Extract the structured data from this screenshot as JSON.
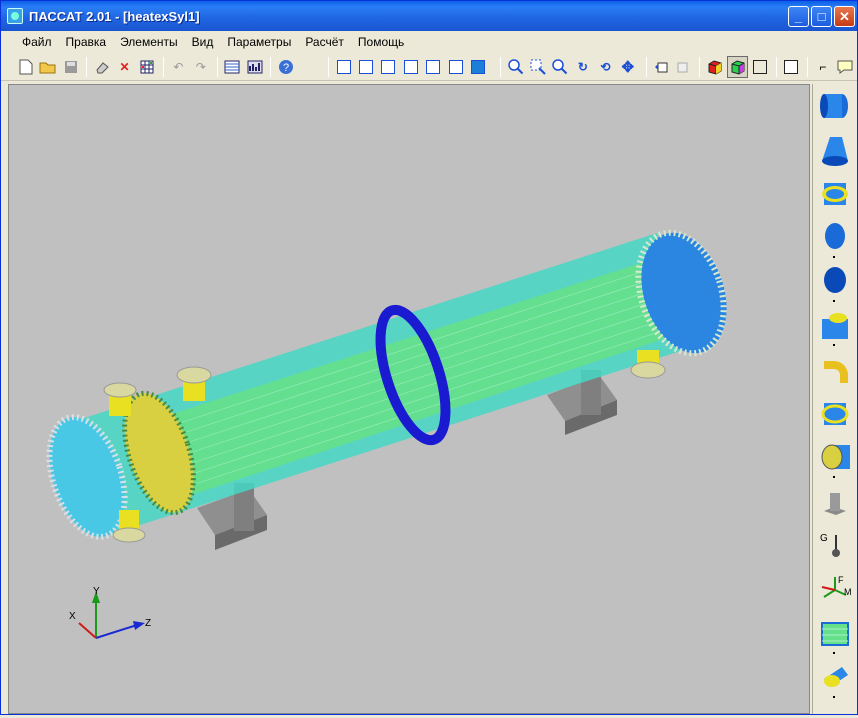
{
  "window": {
    "title": "ПАССАТ 2.01 - [heatexSyl1]"
  },
  "menu": [
    "Файл",
    "Правка",
    "Элементы",
    "Вид",
    "Параметры",
    "Расчёт",
    "Помощь"
  ],
  "toolbar": {
    "file": [
      "new-icon",
      "open-icon",
      "save-icon"
    ],
    "edit": [
      "eraser-icon",
      "delete-icon",
      "grid-icon",
      "undo-icon",
      "redo-icon",
      "table-icon",
      "report-icon",
      "help-icon"
    ],
    "views": [
      "view-front-icon",
      "view-back-icon",
      "view-left-icon",
      "view-right-icon",
      "view-top-icon",
      "view-bottom-icon",
      "view-iso-icon"
    ],
    "zoom": [
      "zoom-in-icon",
      "zoom-window-icon",
      "zoom-icon",
      "rotate-icon",
      "rotate-free-icon",
      "pan-icon"
    ],
    "misc": [
      "undo-view-icon",
      "redo-view-icon",
      "shaded-icon",
      "shaded-edges-icon",
      "wireframe-icon",
      "hidden-lines-icon",
      "measure-icon",
      "annotation-icon"
    ]
  },
  "axes": {
    "x": "X",
    "y": "Y",
    "z": "Z"
  },
  "palette": [
    "shell-cylinder-icon",
    "cone-icon",
    "flange-ring-icon",
    "head-ellipse-icon",
    "head-flat-icon",
    "nozzle-icon",
    "elbow-icon",
    "expansion-joint-icon",
    "tubesheet-icon",
    "saddle-support-icon",
    "gravity-load-icon",
    "force-moment-icon",
    "tube-bundle-icon",
    "nozzle-shell-icon"
  ],
  "colors": {
    "accent": "#0a5fe8",
    "shell": "#3fd3c8",
    "tubes": "#6fe08f",
    "flange": "#1a1ad0",
    "nozzle": "#e8e020",
    "support": "#9a9a9a"
  }
}
